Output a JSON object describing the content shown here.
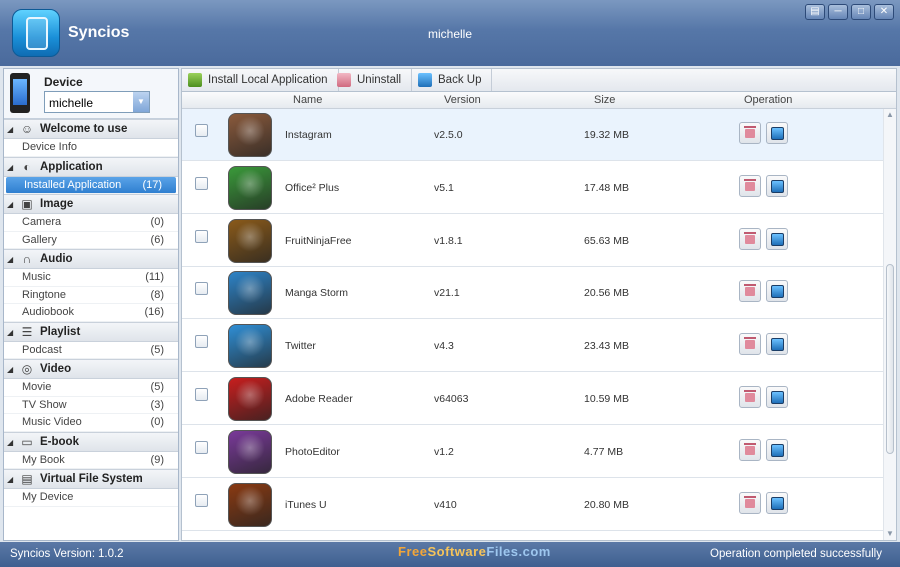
{
  "window": {
    "app_name": "Syncios",
    "device_title": "michelle",
    "buttons": [
      "feedback-icon",
      "minimize-icon",
      "maximize-icon",
      "close-icon"
    ]
  },
  "sidebar": {
    "device_label": "Device",
    "device_select_value": "michelle",
    "categories": [
      {
        "label": "Welcome to use",
        "icon": "users-icon",
        "items": [
          {
            "label": "Device Info",
            "count": ""
          }
        ]
      },
      {
        "label": "Application",
        "icon": "app-icon",
        "items": [
          {
            "label": "Installed Application",
            "count": "(17)",
            "active": true
          }
        ]
      },
      {
        "label": "Image",
        "icon": "image-icon",
        "items": [
          {
            "label": "Camera",
            "count": "(0)"
          },
          {
            "label": "Gallery",
            "count": "(6)"
          }
        ]
      },
      {
        "label": "Audio",
        "icon": "headphones-icon",
        "items": [
          {
            "label": "Music",
            "count": "(11)"
          },
          {
            "label": "Ringtone",
            "count": "(8)"
          },
          {
            "label": "Audiobook",
            "count": "(16)"
          }
        ]
      },
      {
        "label": "Playlist",
        "icon": "playlist-icon",
        "items": [
          {
            "label": "Podcast",
            "count": "(5)"
          }
        ]
      },
      {
        "label": "Video",
        "icon": "video-icon",
        "items": [
          {
            "label": "Movie",
            "count": "(5)"
          },
          {
            "label": "TV Show",
            "count": "(3)"
          },
          {
            "label": "Music Video",
            "count": "(0)"
          }
        ]
      },
      {
        "label": "E-book",
        "icon": "book-icon",
        "items": [
          {
            "label": "My Book",
            "count": "(9)"
          }
        ]
      },
      {
        "label": "Virtual File System",
        "icon": "files-icon",
        "items": [
          {
            "label": "My Device",
            "count": ""
          }
        ]
      }
    ]
  },
  "toolbar": {
    "install_label": "Install Local Application",
    "uninstall_label": "Uninstall",
    "backup_label": "Back Up"
  },
  "table": {
    "columns": {
      "name": "Name",
      "version": "Version",
      "size": "Size",
      "operation": "Operation"
    },
    "rows": [
      {
        "name": "Instagram",
        "version": "v2.5.0",
        "size": "19.32 MB",
        "icon": "instagram-icon",
        "color": "#8a5a3c"
      },
      {
        "name": "Office² Plus",
        "version": "v5.1",
        "size": "17.48 MB",
        "icon": "office-plus-icon",
        "color": "#3a9a3a"
      },
      {
        "name": "FruitNinjaFree",
        "version": "v1.8.1",
        "size": "65.63 MB",
        "icon": "fruit-ninja-icon",
        "color": "#8a5a1a"
      },
      {
        "name": "Manga Storm",
        "version": "v21.1",
        "size": "20.56 MB",
        "icon": "manga-storm-icon",
        "color": "#2e84c8"
      },
      {
        "name": "Twitter",
        "version": "v4.3",
        "size": "23.43 MB",
        "icon": "twitter-icon",
        "color": "#2f8fd6"
      },
      {
        "name": "Adobe Reader",
        "version": "v64063",
        "size": "10.59 MB",
        "icon": "adobe-reader-icon",
        "color": "#c81e1e"
      },
      {
        "name": "PhotoEditor",
        "version": "v1.2",
        "size": "4.77 MB",
        "icon": "photo-editor-icon",
        "color": "#7a3a9a"
      },
      {
        "name": "iTunes U",
        "version": "v410",
        "size": "20.80 MB",
        "icon": "itunes-u-icon",
        "color": "#8a3a12"
      }
    ]
  },
  "statusbar": {
    "version_label": "Syncios Version:",
    "version_value": "1.0.2",
    "watermark": [
      "Free",
      "Software",
      "Files.com"
    ],
    "message": "Operation completed successfully"
  }
}
